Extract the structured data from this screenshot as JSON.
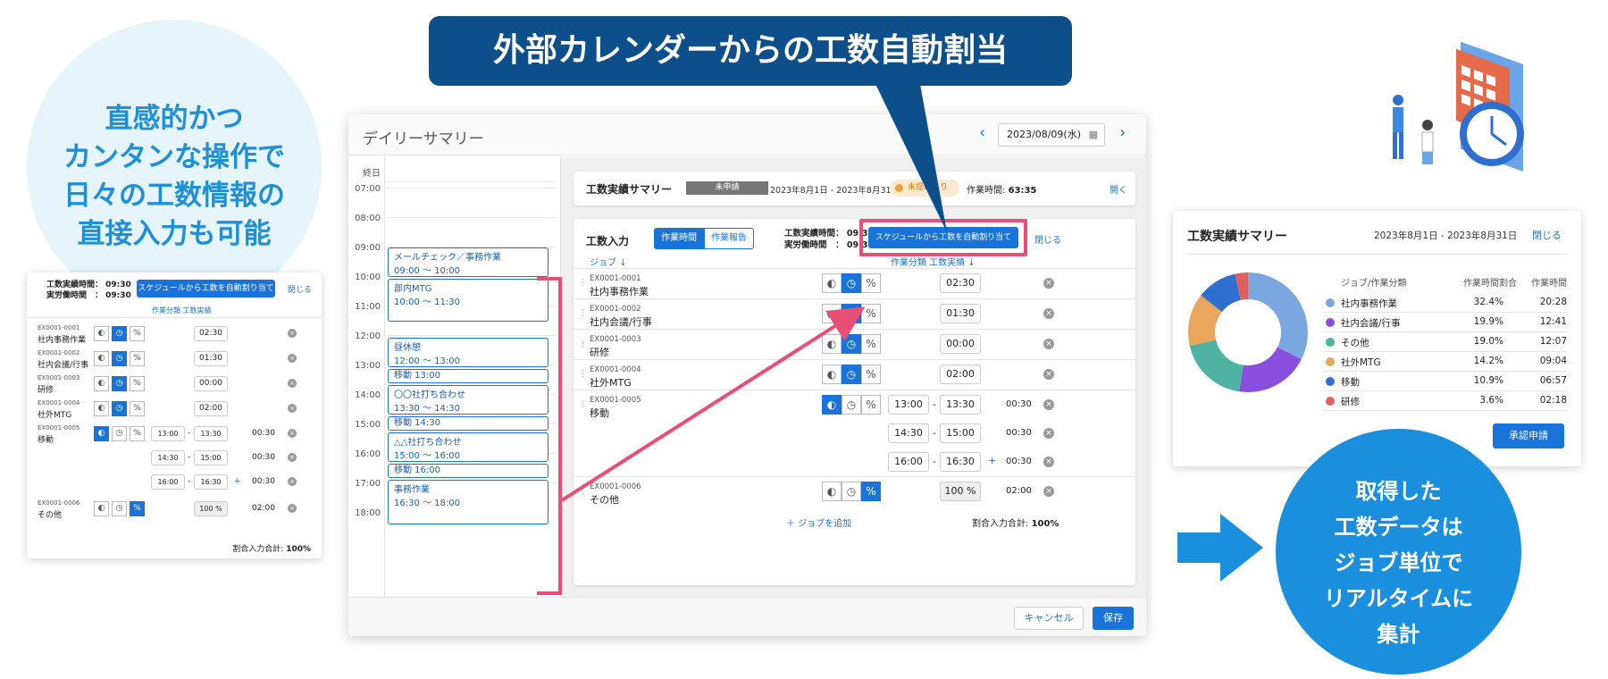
{
  "headline": "外部カレンダーからの工数自動割当",
  "left_bubble": {
    "lines": [
      "直感的かつ",
      "カンタンな操作で",
      "日々の工数情報の",
      "直接入力も可能"
    ]
  },
  "right_bubble": {
    "lines": [
      "取得した",
      "工数データは",
      "ジョブ単位で",
      "リアルタイムに",
      "集計"
    ]
  },
  "main": {
    "title": "デイリーサマリー",
    "date": "2023/08/09(水)",
    "timeline": {
      "allday_label": "終日",
      "hours": [
        "07:00",
        "08:00",
        "09:00",
        "10:00",
        "11:00",
        "12:00",
        "13:00",
        "14:00",
        "15:00",
        "16:00",
        "17:00",
        "18:00"
      ],
      "events": [
        {
          "title": "メールチェック／事務作業",
          "time": "09:00 〜 10:00"
        },
        {
          "title": "部内MTG",
          "time": "10:00 〜 11:30"
        },
        {
          "title": "昼休憩",
          "time": "12:00 〜 13:00"
        },
        {
          "title": "移動 13:00",
          "time": ""
        },
        {
          "title": "〇〇社打ち合わせ",
          "time": "13:30 〜 14:30"
        },
        {
          "title": "移動 14:30",
          "time": ""
        },
        {
          "title": "△△社打ち合わせ",
          "time": "15:00 〜 16:00"
        },
        {
          "title": "移動 16:00",
          "time": ""
        },
        {
          "title": "事務作業",
          "time": "16:30 〜 18:00"
        }
      ]
    },
    "summary_bar": {
      "title": "工数実績サマリー",
      "status": "未申請",
      "period": "2023年8月1日 - 2023年8月31日",
      "badge": "未提出あり",
      "work_time_label": "作業時間:",
      "work_time": "63:35",
      "open": "開く"
    },
    "input": {
      "title": "工数入力",
      "tab_time": "作業時間",
      "tab_report": "作業報告",
      "actual_label": "工数実績時間：",
      "actual_value": "09:30",
      "labor_label": "実労働時間　：",
      "labor_value": "09:30",
      "auto_button": "スケジュールから工数を自動割り当て",
      "close": "閉じる",
      "col_job": "ジョブ",
      "col_class": "作業分類 工数実績",
      "rows": [
        {
          "code": "EX0001-0001",
          "name": "社内事務作業",
          "value": "02:30"
        },
        {
          "code": "EX0001-0002",
          "name": "社内会議/行事",
          "value": "01:30"
        },
        {
          "code": "EX0001-0003",
          "name": "研修",
          "value": "00:00"
        },
        {
          "code": "EX0001-0004",
          "name": "社外MTG",
          "value": "02:00"
        },
        {
          "code": "EX0001-0005",
          "name": "移動",
          "ranges": [
            {
              "from": "13:00",
              "to": "13:30",
              "dur": "00:30"
            },
            {
              "from": "14:30",
              "to": "15:00",
              "dur": "00:30"
            },
            {
              "from": "16:00",
              "to": "16:30",
              "dur": "00:30"
            }
          ]
        },
        {
          "code": "EX0001-0006",
          "name": "その他",
          "pct": "100",
          "pct_unit": "%",
          "dur": "02:00"
        }
      ],
      "add_job": "＋ ジョブを追加",
      "ratio_label": "割合入力合計:",
      "ratio_value": "100%"
    },
    "cancel": "キャンセル",
    "save": "保存"
  },
  "small_card": {
    "actual_label": "工数実績時間：",
    "actual_value": "09:30",
    "labor_label": "実労働時間　：",
    "labor_value": "09:30",
    "auto_button": "スケジュールから工数を自動割り当て",
    "close": "閉じる",
    "col_class": "作業分類 工数実績",
    "rows": [
      {
        "code": "EX0001-0001",
        "name": "社内事務作業",
        "value": "02:30"
      },
      {
        "code": "EX0001-0002",
        "name": "社内会議/行事",
        "value": "01:30"
      },
      {
        "code": "EX0001-0003",
        "name": "研修",
        "value": "00:00"
      },
      {
        "code": "EX0001-0004",
        "name": "社外MTG",
        "value": "02:00"
      },
      {
        "code": "EX0001-0005",
        "name": "移動",
        "ranges": [
          {
            "from": "13:00",
            "to": "13:30",
            "dur": "00:30"
          },
          {
            "from": "14:30",
            "to": "15:00",
            "dur": "00:30"
          },
          {
            "from": "16:00",
            "to": "16:30",
            "dur": "00:30"
          }
        ]
      },
      {
        "code": "EX0001-0006",
        "name": "その他",
        "pct": "100",
        "pct_unit": "%",
        "dur": "02:00"
      }
    ],
    "ratio_label": "割合入力合計:",
    "ratio_value": "100%"
  },
  "summary_card": {
    "title": "工数実績サマリー",
    "period": "2023年8月1日 - 2023年8月31日",
    "close": "閉じる",
    "col_job": "ジョブ/作業分類",
    "col_pct": "作業時間割合",
    "col_time": "作業時間",
    "approve": "承認申請"
  },
  "chart_data": {
    "type": "pie",
    "categories": [
      "社内事務作業",
      "社内会議/行事",
      "その他",
      "社外MTG",
      "移動",
      "研修"
    ],
    "values": [
      32.4,
      19.9,
      19.0,
      14.2,
      10.9,
      3.6
    ],
    "pct_labels": [
      "32.4%",
      "19.9%",
      "19.0%",
      "14.2%",
      "10.9%",
      "3.6%"
    ],
    "times": [
      "20:28",
      "12:41",
      "12:07",
      "09:04",
      "06:57",
      "02:18"
    ],
    "colors": [
      "#7aa7e0",
      "#8b4fe0",
      "#4fb3a3",
      "#e9a65c",
      "#2f6fd0",
      "#e06060"
    ]
  }
}
